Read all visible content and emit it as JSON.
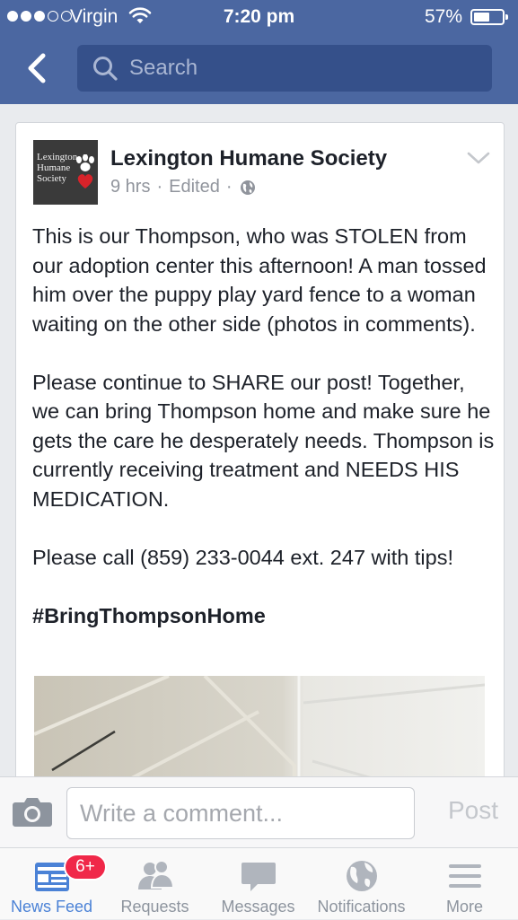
{
  "status_bar": {
    "carrier": "Virgin",
    "time": "7:20 pm",
    "battery_percent_label": "57%",
    "battery_level": 0.57,
    "signal_bars_filled": 3,
    "signal_bars_total": 5
  },
  "header": {
    "search_placeholder": "Search",
    "accent_color": "#4b67a1"
  },
  "post": {
    "page_name": "Lexington Humane Society",
    "avatar_text": "Lexington Humane Society",
    "time": "9 hrs",
    "edited": "Edited",
    "separator": "·",
    "privacy_icon": "globe-icon",
    "paragraphs": [
      "This is our Thompson, who was STOLEN from our adoption center this afternoon! A man tossed him over the puppy play yard fence to a woman waiting on the other side (photos in comments).",
      "Please continue to SHARE our post! Together, we can bring Thompson home and make sure he gets the care he desperately needs. Thompson is currently receiving treatment and NEEDS HIS MEDICATION.",
      "Please call (859) 233-0044 ext. 247 with tips!"
    ],
    "hashtag": "#BringThompsonHome"
  },
  "comment_bar": {
    "placeholder": "Write a comment...",
    "post_label": "Post"
  },
  "tabs": [
    {
      "label": "News Feed",
      "icon": "news-feed-icon",
      "active": true,
      "badge": "6+"
    },
    {
      "label": "Requests",
      "icon": "friend-requests-icon",
      "active": false
    },
    {
      "label": "Messages",
      "icon": "messages-icon",
      "active": false
    },
    {
      "label": "Notifications",
      "icon": "globe-icon",
      "active": false
    },
    {
      "label": "More",
      "icon": "menu-icon",
      "active": false
    }
  ]
}
